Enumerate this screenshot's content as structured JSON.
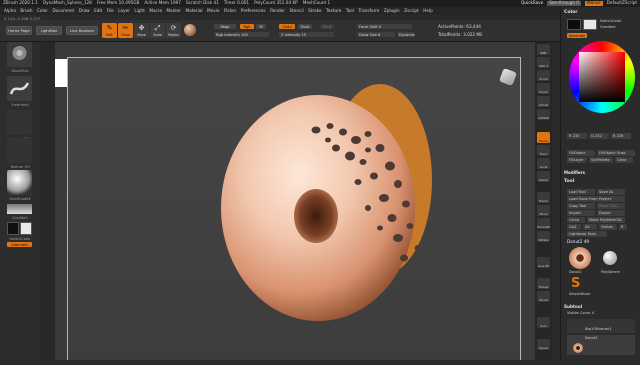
{
  "titlebar": {
    "app": "ZBrush 2020.1.1",
    "doc": "DynaMesh_Sphere_128",
    "stats": [
      "Free Mem 10.495GB",
      "Active Mem 1997",
      "Scratch Disk 41",
      "Timer 0.001",
      "PolyCount 351.04 KP",
      "MeshCount 1"
    ],
    "quicksave": "QuickSave",
    "seethrough": "See-through 0",
    "menus": "Menus",
    "script": "DefaultZScript"
  },
  "menubar": [
    "Alpha",
    "Brush",
    "Color",
    "Document",
    "Draw",
    "Edit",
    "File",
    "Layer",
    "Light",
    "Macro",
    "Marker",
    "Material",
    "Movie",
    "Picker",
    "Preferences",
    "Render",
    "Stencil",
    "Stroke",
    "Texture",
    "Tool",
    "Transform",
    "Zplugin",
    "Zscript",
    "Help"
  ],
  "coords": "0.144,-0.308,0.157",
  "topbar": {
    "home_page": "Home Page",
    "lightbox": "LightBox",
    "live_boolean": "Live Boolean",
    "tools": [
      {
        "label": "Edit",
        "glyph": "✎",
        "active": true
      },
      {
        "label": "Draw",
        "glyph": "✏",
        "active": true
      },
      {
        "label": "Move",
        "glyph": "✥",
        "active": false
      },
      {
        "label": "Scale",
        "glyph": "⤢",
        "active": false
      },
      {
        "label": "Rotate",
        "glyph": "⟳",
        "active": false
      }
    ],
    "mrgb": "Mrgb",
    "rgb": "Rgb",
    "m": "M",
    "zadd": "Zadd",
    "zsub": "Zsub",
    "zcut": "Zcut",
    "rgb_intensity": "Rgb Intensity 100",
    "z_intensity": "Z Intensity 25",
    "focal_shift": "Focal Shift 0",
    "draw_size": "Draw Size 8",
    "dynamic": "Dynamic",
    "active_points": "ActivePoints: 63,444",
    "total_points": "TotalPoints: 3.022 Mil"
  },
  "leftpanel": {
    "brush": "MoveElas",
    "stroke": "FreeHand",
    "alpha": "Alpha Off",
    "texture": "Texture Off",
    "material": "SkinShade4",
    "gradient": "Gradient",
    "switch_color": "SwitchColor",
    "alternate": "Alternate"
  },
  "rcolumn": [
    {
      "label": "BPR",
      "active": false
    },
    {
      "label": "SPix 3",
      "active": false
    },
    {
      "label": "Scroll",
      "active": false
    },
    {
      "label": "Zoom",
      "active": false
    },
    {
      "label": "Actual",
      "active": false
    },
    {
      "label": "AAHalf",
      "active": false
    },
    {
      "label": "Persp",
      "active": true
    },
    {
      "label": "Floor",
      "active": false
    },
    {
      "label": "Local",
      "active": false
    },
    {
      "label": "Gizmo",
      "active": false
    },
    {
      "label": "Frame",
      "active": false
    },
    {
      "label": "Move",
      "active": false
    },
    {
      "label": "Zoom3D",
      "active": false
    },
    {
      "label": "Rotate",
      "active": false
    },
    {
      "label": "Line Fill",
      "active": false
    },
    {
      "label": "Transp",
      "active": false
    },
    {
      "label": "Ghost",
      "active": false
    },
    {
      "label": "Solo",
      "active": false
    },
    {
      "label": "Xpose",
      "active": false
    }
  ],
  "colorpanel": {
    "header": "Color",
    "switch_color": "SwitchColor",
    "gradient": "Gradient",
    "alternate": "Alternate",
    "r": "R 230",
    "g": "G 232",
    "b": "B 226",
    "fill_object": "FillObject",
    "fill_object_grad": "FillObject Grad",
    "fill_layer": "FillLayer",
    "syspalette": "SysPalette",
    "clear": "Clear",
    "swatch": "#e6e8e2"
  },
  "modifiers": "Modifiers",
  "toolpanel": {
    "header": "Tool",
    "load_tool": "Load Tool",
    "save_as": "Save As",
    "load_from_project": "Load Tools From Project",
    "copy_tool": "Copy Tool",
    "paste_tool": "Paste Tool",
    "import": "Import",
    "export": "Export",
    "clone": "Clone",
    "make_polymesh": "Make PolyMesh3D",
    "goz": "GoZ",
    "all": "All",
    "visible": "Visible",
    "r": "R",
    "lightbox_tools": "Lightbox▸ Tools",
    "current_tool": "Donut2 49",
    "thumb_donut": "Donut2",
    "thumb_polysphere": "PolySphere",
    "thumb_simplebrush": "SimpleBrush",
    "subtool_header": "Subtool",
    "visible_count": "Visible Count 4",
    "subtools": [
      "Box2Offcenter1",
      "Donut2"
    ]
  }
}
